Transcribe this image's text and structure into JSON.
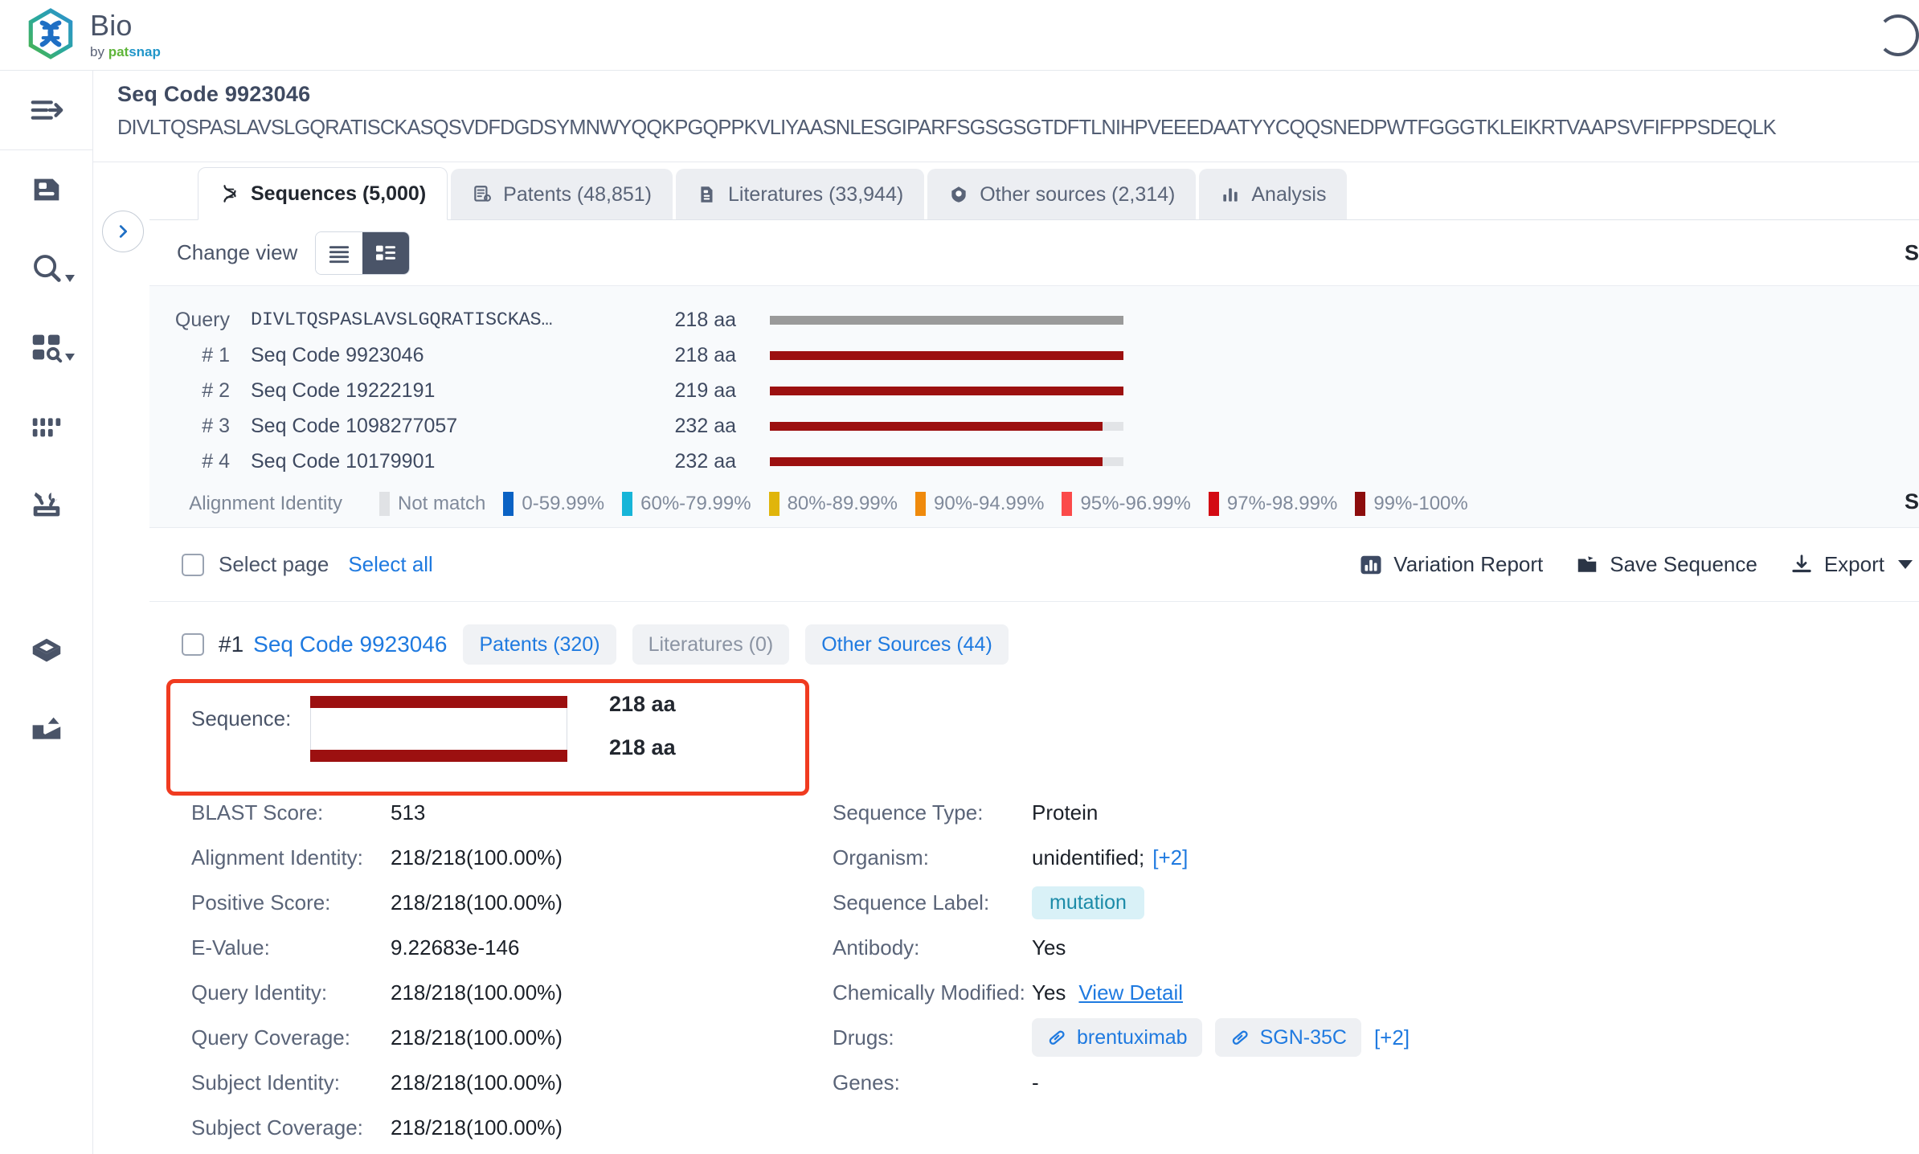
{
  "brand": {
    "logo_icon": "dna-hexagon-logo",
    "title": "Bio",
    "by": "by ",
    "pat": "pat",
    "snap": "snap"
  },
  "rail": {
    "items": [
      {
        "name": "expand-sidebar",
        "icon": "expand-arrow-icon"
      },
      {
        "name": "document",
        "icon": "document-icon"
      },
      {
        "name": "search",
        "icon": "search-icon",
        "caret": true
      },
      {
        "name": "grid-search",
        "icon": "grid-search-icon",
        "caret": true
      },
      {
        "name": "grid-dots",
        "icon": "grid-dots-icon"
      },
      {
        "name": "tools",
        "icon": "tools-icon"
      },
      {
        "name": "cube",
        "icon": "cube-icon"
      },
      {
        "name": "inbox-upload",
        "icon": "inbox-upload-icon"
      }
    ]
  },
  "header": {
    "seq_code": "Seq Code 9923046",
    "sequence": "DIVLTQSPASLAVSLGQRATISCKASQSVDFDGDSYMNWYQQKPGQPPKVLIYAASNLESGIPARFSGSGSGTDFTLNIHPVEEEDAATYYCQQSNEDPWTFGGGTKLEIKRTVAAPSVFIFPPSDEQLK"
  },
  "tabs": [
    {
      "label": "Sequences (5,000)",
      "icon": "dna-icon",
      "active": true
    },
    {
      "label": "Patents (48,851)",
      "icon": "patent-doc-icon",
      "active": false
    },
    {
      "label": "Literatures (33,944)",
      "icon": "literature-icon",
      "active": false
    },
    {
      "label": "Other sources (2,314)",
      "icon": "drop-shield-icon",
      "active": false
    },
    {
      "label": "Analysis",
      "icon": "bar-chart-icon",
      "active": false
    }
  ],
  "viewbar": {
    "label": "Change view",
    "list_icon": "list-view-icon",
    "card_icon": "card-view-icon",
    "right_cut": "S"
  },
  "alignment": {
    "rows": [
      {
        "no": "Query",
        "name": "DIVLTQSPASLAVSLGQRATISCKAS…",
        "length": "218 aa",
        "color": "#9a9a9a",
        "fill_pct": 100,
        "mono": true
      },
      {
        "no": "# 1",
        "name": "Seq Code 9923046",
        "length": "218 aa",
        "color": "#9c1010",
        "fill_pct": 100,
        "mono": false
      },
      {
        "no": "# 2",
        "name": "Seq Code 19222191",
        "length": "219 aa",
        "color": "#9c1010",
        "fill_pct": 100,
        "mono": false
      },
      {
        "no": "# 3",
        "name": "Seq Code 1098277057",
        "length": "232 aa",
        "color": "#9c1010",
        "fill_pct": 94,
        "mono": false
      },
      {
        "no": "# 4",
        "name": "Seq Code 10179901",
        "length": "232 aa",
        "color": "#9c1010",
        "fill_pct": 94,
        "mono": false
      }
    ],
    "legend_title": "Alignment Identity",
    "legend": [
      {
        "label": "Not match",
        "color": "#e0e2e5"
      },
      {
        "label": "0-59.99%",
        "color": "#0a62c4"
      },
      {
        "label": "60%-79.99%",
        "color": "#17b5d8"
      },
      {
        "label": "80%-89.99%",
        "color": "#e0b50b"
      },
      {
        "label": "90%-94.99%",
        "color": "#ef8a0c"
      },
      {
        "label": "95%-96.99%",
        "color": "#fb4a4a"
      },
      {
        "label": "97%-98.99%",
        "color": "#d30a13"
      },
      {
        "label": "99%-100%",
        "color": "#8c0d0d"
      }
    ],
    "right_cut": "S"
  },
  "selectbar": {
    "select_page": "Select page",
    "select_all": "Select all",
    "variation_report": "Variation Report",
    "save_sequence": "Save Sequence",
    "export": "Export",
    "variation_icon": "bar-chart-icon",
    "save_icon": "folder-icon",
    "export_icon": "download-icon",
    "caret_icon": "chevron-down-icon"
  },
  "result": {
    "num": "#1",
    "name": "Seq Code 9923046",
    "pills": [
      {
        "label": "Patents (320)",
        "muted": false
      },
      {
        "label": "Literatures (0)",
        "muted": true
      },
      {
        "label": "Other Sources (44)",
        "muted": false
      }
    ],
    "sequence_label": "Sequence:",
    "seq_len_top": "218 aa",
    "seq_len_bottom": "218 aa",
    "bar_color": "#9c1010",
    "highlight_color": "#f03b20",
    "left_fields": [
      {
        "key": "BLAST Score:",
        "value": "513"
      },
      {
        "key": "Alignment Identity:",
        "value": "218/218(100.00%)"
      },
      {
        "key": "Positive Score:",
        "value": "218/218(100.00%)"
      },
      {
        "key": "E-Value:",
        "value": "9.22683e-146"
      },
      {
        "key": "Query Identity:",
        "value": "218/218(100.00%)"
      },
      {
        "key": "Query Coverage:",
        "value": "218/218(100.00%)"
      },
      {
        "key": "Subject Identity:",
        "value": "218/218(100.00%)"
      },
      {
        "key": "Subject Coverage:",
        "value": "218/218(100.00%)"
      }
    ],
    "right_fields": {
      "sequence_type_key": "Sequence Type:",
      "sequence_type_value": "Protein",
      "organism_key": "Organism:",
      "organism_value": "unidentified;",
      "organism_more": "[+2]",
      "sequence_label_key": "Sequence Label:",
      "sequence_label_value": "mutation",
      "antibody_key": "Antibody:",
      "antibody_value": "Yes",
      "chem_mod_key": "Chemically Modified:",
      "chem_mod_value": "Yes",
      "chem_mod_link": "View Detail",
      "drugs_key": "Drugs:",
      "drugs": [
        "brentuximab",
        "SGN-35C"
      ],
      "drugs_more": "[+2]",
      "drug_icon": "pill-icon",
      "genes_key": "Genes:",
      "genes_value": "-"
    }
  }
}
